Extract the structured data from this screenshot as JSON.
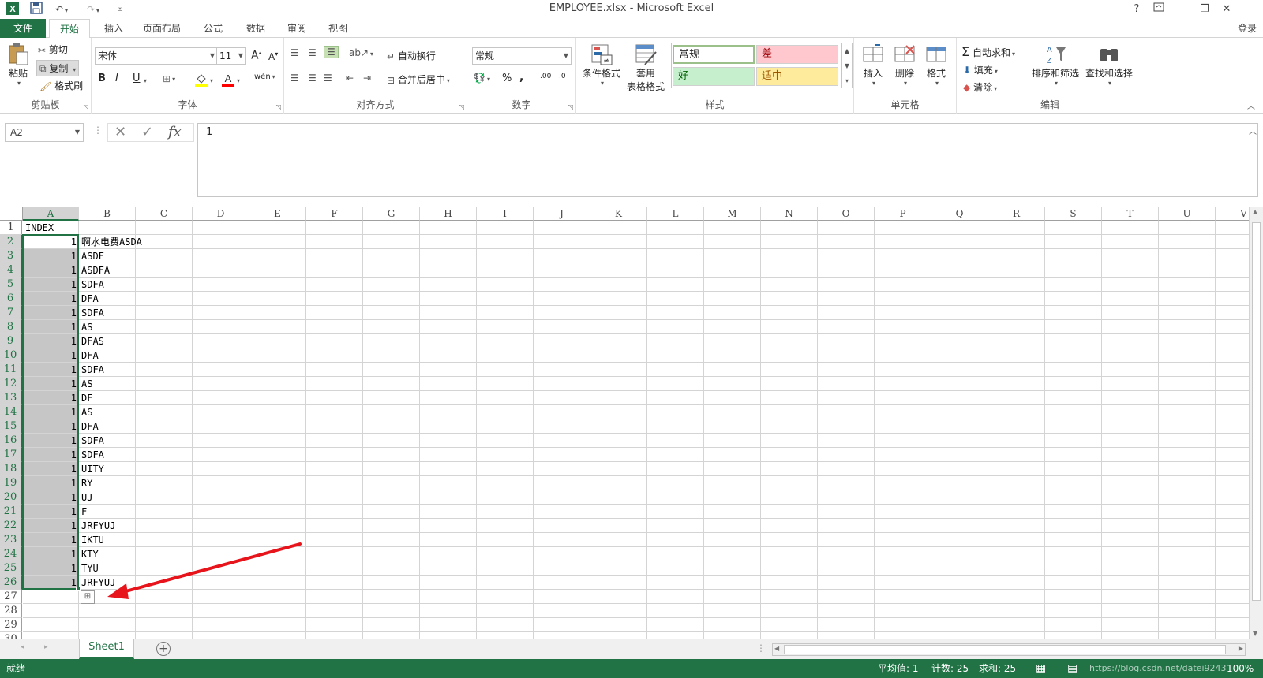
{
  "window": {
    "title": "EMPLOYEE.xlsx - Microsoft Excel",
    "help": "?",
    "minimize": "—",
    "restore": "❐",
    "close": "✕"
  },
  "tabs": {
    "file": "文件",
    "items": [
      "开始",
      "插入",
      "页面布局",
      "公式",
      "数据",
      "审阅",
      "视图"
    ],
    "login": "登录"
  },
  "ribbon": {
    "clipboard": {
      "label": "剪贴板",
      "paste": "粘贴",
      "cut": "剪切",
      "copy": "复制",
      "format_painter": "格式刷"
    },
    "font": {
      "label": "字体",
      "name": "宋体",
      "size": "11",
      "bold": "B",
      "italic": "I",
      "underline": "U",
      "increase": "A",
      "decrease": "A"
    },
    "alignment": {
      "label": "对齐方式",
      "wrap": "自动换行",
      "merge": "合并后居中"
    },
    "number": {
      "label": "数字",
      "format": "常规",
      "percent": "%",
      "comma": ",",
      "inc_dec": ".00",
      "dec_dec": ".0"
    },
    "styles": {
      "label": "样式",
      "conditional": "条件格式",
      "table1": "套用",
      "table2": "表格格式",
      "normal": "常规",
      "bad": "差",
      "good": "好",
      "neutral": "适中"
    },
    "cells": {
      "label": "单元格",
      "insert": "插入",
      "delete": "删除",
      "format": "格式"
    },
    "editing": {
      "label": "编辑",
      "autosum": "自动求和",
      "fill": "填充",
      "clear": "清除",
      "sort": "排序和筛选",
      "find": "查找和选择"
    }
  },
  "formula_bar": {
    "name_box": "A2",
    "value": "1",
    "cancel": "✕",
    "enter": "✓",
    "fx": "fx"
  },
  "columns": [
    "A",
    "B",
    "C",
    "D",
    "E",
    "F",
    "G",
    "H",
    "I",
    "J",
    "K",
    "L",
    "M",
    "N",
    "O",
    "P",
    "Q",
    "R",
    "S",
    "T",
    "U",
    "V"
  ],
  "rows": [
    "1",
    "2",
    "3",
    "4",
    "5",
    "6",
    "7",
    "8",
    "9",
    "10",
    "11",
    "12",
    "13",
    "14",
    "15",
    "16",
    "17",
    "18",
    "19",
    "20",
    "21",
    "22",
    "23",
    "24",
    "25",
    "26",
    "27",
    "28",
    "29",
    "30"
  ],
  "cells": {
    "A1": "INDEX",
    "A": [
      "1",
      "1",
      "1",
      "1",
      "1",
      "1",
      "1",
      "1",
      "1",
      "1",
      "1",
      "1",
      "1",
      "1",
      "1",
      "1",
      "1",
      "1",
      "1",
      "1",
      "1",
      "1",
      "1",
      "1",
      "1"
    ],
    "B": [
      "啊水电费ASDA",
      "ASDF",
      "ASDFA",
      "SDFA",
      "DFA",
      "SDFA",
      "AS",
      "DFAS",
      "DFA",
      "SDFA",
      "AS",
      "DF",
      "AS",
      "DFA",
      "SDFA",
      "SDFA",
      "UITY",
      "RY",
      "UJ",
      "F",
      "JRFYUJ",
      "IKTU",
      "KTY",
      "TYU",
      "JRFYUJ"
    ]
  },
  "sheet": {
    "name": "Sheet1",
    "add": "+"
  },
  "status": {
    "ready": "就绪",
    "average": "平均值: 1",
    "count": "计数: 25",
    "sum": "求和: 25",
    "zoom": "100%",
    "watermark": "https://blog.csdn.net/datei9243"
  },
  "colors": {
    "accent": "#217346",
    "selection": "#c6c6c6",
    "arrow": "#e8141b"
  }
}
